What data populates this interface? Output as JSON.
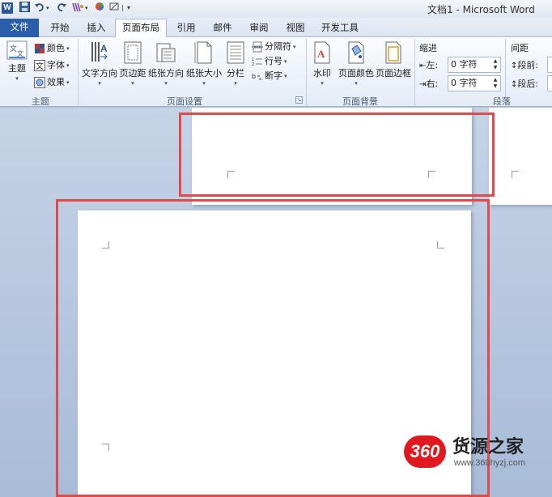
{
  "window": {
    "title": "文档1 - Microsoft Word",
    "app_icon": "W"
  },
  "quick_access": {
    "items": [
      "save-icon",
      "undo-icon",
      "redo-icon",
      "format-painter-icon",
      "color-icon",
      "clear-icon",
      "customize-icon"
    ]
  },
  "tabs": [
    {
      "label": "文件"
    },
    {
      "label": "开始"
    },
    {
      "label": "插入"
    },
    {
      "label": "页面布局"
    },
    {
      "label": "引用"
    },
    {
      "label": "邮件"
    },
    {
      "label": "审阅"
    },
    {
      "label": "视图"
    },
    {
      "label": "开发工具"
    }
  ],
  "ribbon": {
    "theme": {
      "label": "主题",
      "themes_btn": "主题",
      "colors_btn": "颜色",
      "fonts_btn": "字体",
      "effects_btn": "效果"
    },
    "page_setup": {
      "label": "页面设置",
      "text_direction": "文字方向",
      "margins": "页边距",
      "orientation": "纸张方向",
      "size": "纸张大小",
      "columns": "分栏",
      "breaks": "分隔符",
      "line_numbers": "行号",
      "hyphenation": "断字"
    },
    "page_background": {
      "label": "页面背景",
      "watermark": "水印",
      "page_color": "页面颜色",
      "page_borders": "页面边框"
    },
    "paragraph": {
      "label": "段落",
      "indent_title": "缩进",
      "indent_left_label": "左:",
      "indent_left_value": "0 字符",
      "indent_right_label": "右:",
      "indent_right_value": "0 字符",
      "spacing_title": "间距",
      "spacing_before_label": "段前:",
      "spacing_after_label": "段后:"
    }
  },
  "colors": {
    "file_tab": "#2a5ea9",
    "highlight": "#e04a4a",
    "brand_red": "#e1191e"
  },
  "watermark": {
    "badge": "360",
    "name": "货源之家",
    "url": "www.360hyzj.com"
  }
}
